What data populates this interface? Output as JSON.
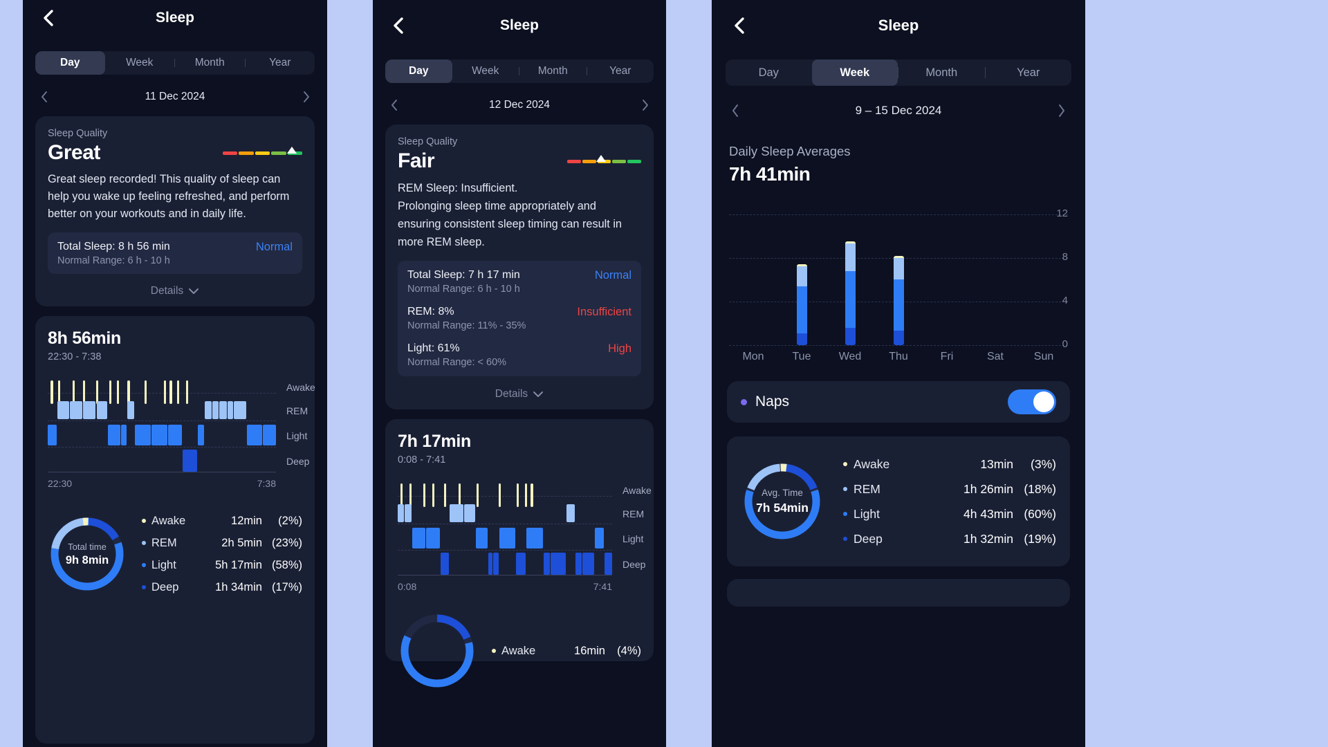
{
  "colors": {
    "bg": "#bdcdf7",
    "panel": "#0c1020",
    "card": "#1a2034",
    "metrics": "#222942",
    "accent_blue": "#3b82f6",
    "red": "#ef4444",
    "awake": "#f4f3c0",
    "rem": "#9dc3f7",
    "light": "#2f7df6",
    "deep": "#1d4fd8",
    "nap_purple": "#7c6bf0",
    "toggle_on": "#2f7df6"
  },
  "panel1": {
    "header": {
      "back_icon": "chevron-left-icon",
      "title": "Sleep"
    },
    "tabs": {
      "items": [
        "Day",
        "Week",
        "Month",
        "Year"
      ],
      "active": "Day"
    },
    "date_nav": {
      "prev_icon": "chevron-left-icon",
      "next_icon": "chevron-right-icon",
      "label": "11 Dec 2024"
    },
    "quality_card": {
      "label": "Sleep Quality",
      "word": "Great",
      "gauge": {
        "segments": [
          "#ef4444",
          "#f59e0b",
          "#facc15",
          "#84cc16",
          "#22c55e"
        ],
        "marker_position_pct": 88
      },
      "description": "Great sleep recorded! This quality of sleep can help you wake up feeling refreshed, and perform better on your workouts and in daily life.",
      "metrics": [
        {
          "title": "Total Sleep: 8 h 56 min",
          "range": "Normal Range: 6 h - 10 h",
          "status": "Normal",
          "status_kind": "normal"
        }
      ],
      "details_label": "Details",
      "details_icon": "chevron-down-icon"
    },
    "hypnogram": {
      "duration": "8h 56min",
      "time_range": "22:30 - 7:38",
      "lanes": [
        "Awake",
        "REM",
        "Light",
        "Deep"
      ],
      "axis_start": "22:30",
      "axis_end": "7:38"
    },
    "summary": {
      "donut_center_label": "Total time",
      "donut_center_value": "9h 8min",
      "rows": [
        {
          "name": "Awake",
          "value": "12min",
          "pct": "(2%)",
          "color": "#f4f3c0"
        },
        {
          "name": "REM",
          "value": "2h 5min",
          "pct": "(23%)",
          "color": "#9dc3f7"
        },
        {
          "name": "Light",
          "value": "5h 17min",
          "pct": "(58%)",
          "color": "#2f7df6"
        },
        {
          "name": "Deep",
          "value": "1h 34min",
          "pct": "(17%)",
          "color": "#1d4fd8"
        }
      ]
    }
  },
  "panel2": {
    "header": {
      "back_icon": "chevron-left-icon",
      "title": "Sleep"
    },
    "tabs": {
      "items": [
        "Day",
        "Week",
        "Month",
        "Year"
      ],
      "active": "Day"
    },
    "date_nav": {
      "prev_icon": "chevron-left-icon",
      "next_icon": "chevron-right-icon",
      "label": "12 Dec 2024"
    },
    "quality_card": {
      "label": "Sleep Quality",
      "word": "Fair",
      "gauge": {
        "segments": [
          "#ef4444",
          "#f59e0b",
          "#facc15",
          "#84cc16",
          "#22c55e"
        ],
        "marker_position_pct": 46
      },
      "description": "REM Sleep: Insufficient.\nProlonging sleep time appropriately and ensuring consistent sleep timing can result in more REM sleep.",
      "metrics": [
        {
          "title": "Total Sleep: 7 h 17 min",
          "range": "Normal Range: 6 h - 10 h",
          "status": "Normal",
          "status_kind": "normal"
        },
        {
          "title": "REM: 8%",
          "range": "Normal Range: 11% - 35%",
          "status": "Insufficient",
          "status_kind": "insufficient"
        },
        {
          "title": "Light: 61%",
          "range": "Normal Range:  < 60%",
          "status": "High",
          "status_kind": "high"
        }
      ],
      "details_label": "Details",
      "details_icon": "chevron-down-icon"
    },
    "hypnogram": {
      "duration": "7h 17min",
      "time_range": "0:08 - 7:41",
      "lanes": [
        "Awake",
        "REM",
        "Light",
        "Deep"
      ],
      "axis_start": "0:08",
      "axis_end": "7:41"
    },
    "summary": {
      "rows": [
        {
          "name": "Awake",
          "value": "16min",
          "pct": "(4%)",
          "color": "#f4f3c0"
        }
      ]
    }
  },
  "panel3": {
    "header": {
      "back_icon": "chevron-left-icon",
      "title": "Sleep"
    },
    "tabs": {
      "items": [
        "Day",
        "Week",
        "Month",
        "Year"
      ],
      "active": "Week"
    },
    "date_nav": {
      "prev_icon": "chevron-left-icon",
      "next_icon": "chevron-right-icon",
      "label": "9 – 15 Dec 2024"
    },
    "averages": {
      "label": "Daily Sleep Averages",
      "value": "7h 41min"
    },
    "naps": {
      "label": "Naps",
      "enabled": true,
      "dot_color": "#7c6bf0"
    },
    "summary": {
      "donut_center_label": "Avg. Time",
      "donut_center_value": "7h 54min",
      "rows": [
        {
          "name": "Awake",
          "value": "13min",
          "pct": "(3%)",
          "color": "#f4f3c0"
        },
        {
          "name": "REM",
          "value": "1h 26min",
          "pct": "(18%)",
          "color": "#9dc3f7"
        },
        {
          "name": "Light",
          "value": "4h 43min",
          "pct": "(60%)",
          "color": "#2f7df6"
        },
        {
          "name": "Deep",
          "value": "1h 32min",
          "pct": "(19%)",
          "color": "#1d4fd8"
        }
      ]
    },
    "chart_data": {
      "type": "bar",
      "title": "Daily Sleep Averages",
      "subtitle": "7h 41min",
      "categories": [
        "Mon",
        "Tue",
        "Wed",
        "Thu",
        "Fri",
        "Sat",
        "Sun"
      ],
      "ylabel": "",
      "xlabel": "",
      "ylim": [
        0,
        13
      ],
      "yticks": [
        0,
        4,
        8,
        12
      ],
      "grid": true,
      "stacked": true,
      "legend_position": "none",
      "series": [
        {
          "name": "Deep",
          "color": "#1d4fd8",
          "values": [
            0,
            1.1,
            1.6,
            1.3,
            0,
            0,
            0
          ]
        },
        {
          "name": "Light",
          "color": "#2f7df6",
          "values": [
            0,
            4.3,
            5.2,
            4.7,
            0,
            0,
            0
          ]
        },
        {
          "name": "REM",
          "color": "#9dc3f7",
          "values": [
            0,
            1.8,
            2.5,
            2.0,
            0,
            0,
            0
          ]
        },
        {
          "name": "Awake",
          "color": "#f4f3c0",
          "values": [
            0,
            0.2,
            0.2,
            0.2,
            0,
            0,
            0
          ]
        }
      ],
      "totals": [
        0,
        7.4,
        9.5,
        8.2,
        0,
        0,
        0
      ]
    }
  }
}
